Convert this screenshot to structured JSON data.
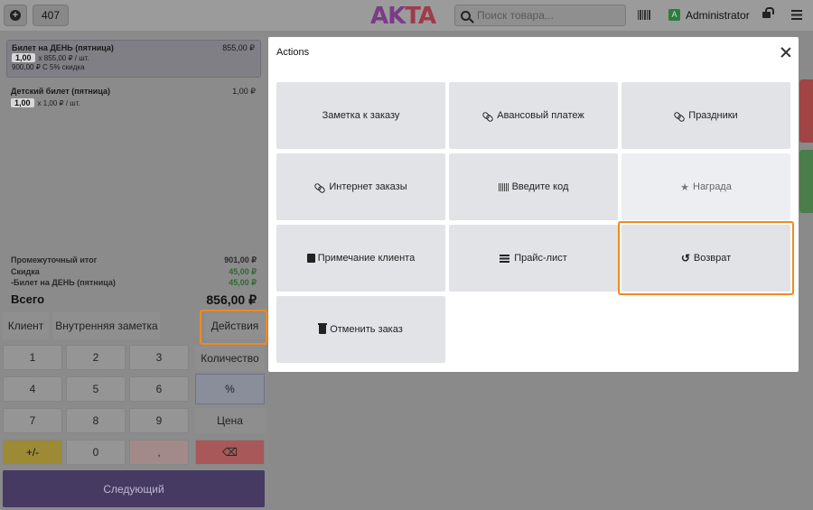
{
  "topbar": {
    "order_number": "407",
    "logo": "AKTA",
    "search_placeholder": "Поиск товара...",
    "user_initial": "A",
    "user_name": "Administrator"
  },
  "order": {
    "lines": [
      {
        "name": "Билет на ДЕНЬ (пятница)",
        "price": "855,00 ₽",
        "qty": "1,00",
        "unit": "x 855,00 ₽ / шт.",
        "discount": "900,00 ₽ С 5% скидка"
      },
      {
        "name": "Детский билет (пятница)",
        "price": "1,00 ₽",
        "qty": "1,00",
        "unit": "x 1,00 ₽ / шт."
      }
    ],
    "totals": {
      "subtotal_label": "Промежуточный итог",
      "subtotal_value": "901,00 ₽",
      "discount_label": "Скидка",
      "discount_value": "45,00 ₽",
      "discount_item_label": "-Билет на ДЕНЬ (пятница)",
      "discount_item_value": "45,00 ₽",
      "total_label": "Всего",
      "total_value": "856,00 ₽"
    }
  },
  "controls": {
    "client": "Клиент",
    "internal_note": "Внутренняя заметка",
    "actions": "Действия",
    "keys": [
      "1",
      "2",
      "3",
      "4",
      "5",
      "6",
      "7",
      "8",
      "9",
      "+/-",
      "0",
      ","
    ],
    "quantity": "Количество",
    "percent": "%",
    "price": "Цена",
    "backspace": "⌫",
    "next": "Следующий"
  },
  "modal": {
    "title": "Actions",
    "tiles": [
      {
        "label": "Заметка к заказу",
        "icon": "none"
      },
      {
        "label": "Авансовый платеж",
        "icon": "link-icon"
      },
      {
        "label": "Праздники",
        "icon": "link-icon"
      },
      {
        "label": "Интернет заказы",
        "icon": "link-icon"
      },
      {
        "label": "Введите код",
        "icon": "barcode-icon"
      },
      {
        "label": "Награда",
        "icon": "star-icon"
      },
      {
        "label": "Примечание клиента",
        "icon": "note-icon"
      },
      {
        "label": "Прайс-лист",
        "icon": "list-icon"
      },
      {
        "label": "Возврат",
        "icon": "undo-icon"
      },
      {
        "label": "Отменить заказ",
        "icon": "trash-icon"
      }
    ]
  },
  "colors": {
    "highlight": "#f08a1e",
    "next_button": "#463a63",
    "tile_bg": "#e2e3e6"
  }
}
